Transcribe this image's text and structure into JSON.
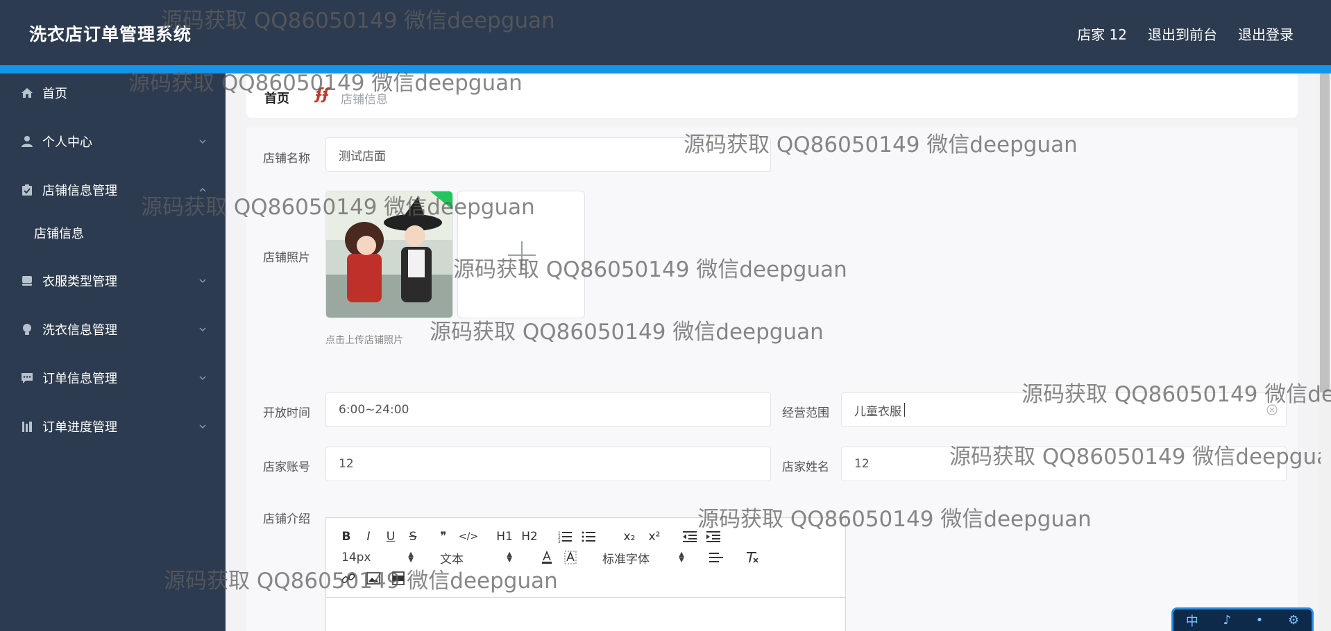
{
  "header": {
    "title": "洗衣店订单管理系统",
    "user": "店家 12",
    "link_front": "退出到前台",
    "link_logout": "退出登录"
  },
  "sidebar": {
    "items": [
      {
        "label": "首页",
        "icon": "home-icon"
      },
      {
        "label": "个人中心",
        "icon": "user-icon"
      },
      {
        "label": "店铺信息管理",
        "icon": "clipboard-icon"
      },
      {
        "label": "店铺信息",
        "icon": ""
      },
      {
        "label": "衣服类型管理",
        "icon": "tray-icon"
      },
      {
        "label": "洗衣信息管理",
        "icon": "bulb-icon"
      },
      {
        "label": "订单信息管理",
        "icon": "chat-icon"
      },
      {
        "label": "订单进度管理",
        "icon": "chart-icon"
      }
    ]
  },
  "breadcrumb": {
    "home": "首页",
    "separator": "ʄʄ",
    "current": "店铺信息"
  },
  "form": {
    "shop_name_label": "店铺名称",
    "shop_name_value": "测试店面",
    "photo_label": "店铺照片",
    "photo_hint": "点击上传店铺照片",
    "open_time_label": "开放时间",
    "open_time_value": "6:00~24:00",
    "scope_label": "经营范围",
    "scope_value": "儿童衣服",
    "account_label": "店家账号",
    "account_value": "12",
    "name_label": "店家姓名",
    "name_value": "12",
    "intro_label": "店铺介绍"
  },
  "editor": {
    "font_size": "14px",
    "paragraph": "文本",
    "font_family": "标准字体",
    "buttons": [
      "B",
      "I",
      "U",
      "S",
      "❞",
      "</>",
      "H1",
      "H2",
      "ol",
      "ul",
      "x₂",
      "x²",
      "outdent",
      "indent"
    ]
  },
  "watermark_text": "源码获取 QQ86050149 微信deepguan",
  "ime": {
    "chars": [
      "中",
      "♪",
      "•",
      "⚙"
    ]
  }
}
